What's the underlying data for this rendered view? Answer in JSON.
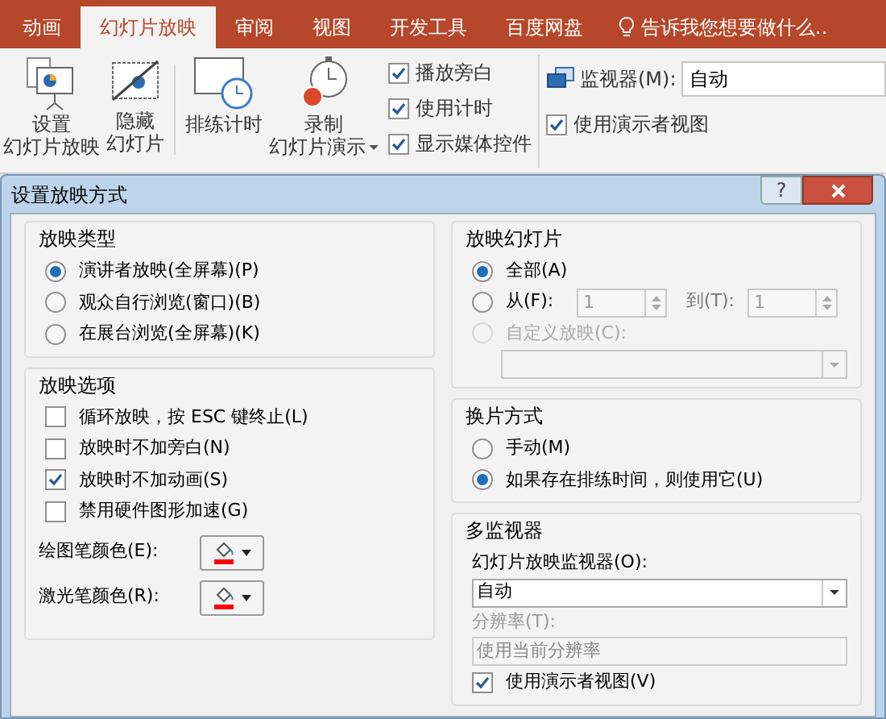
{
  "ribbon": {
    "tabs": [
      {
        "label": "动画",
        "selected": false
      },
      {
        "label": "幻灯片放映",
        "selected": true
      },
      {
        "label": "审阅",
        "selected": false
      },
      {
        "label": "视图",
        "selected": false
      },
      {
        "label": "开发工具",
        "selected": false
      },
      {
        "label": "百度网盘",
        "selected": false
      }
    ],
    "tell_me": "告诉我您想要做什么..",
    "buttons": [
      {
        "kind": "setup",
        "lines": [
          "设置",
          "幻灯片放映"
        ]
      },
      {
        "kind": "hide",
        "lines": [
          "隐藏",
          "幻灯片"
        ]
      },
      {
        "kind": "rehearse",
        "lines": [
          "排练计时"
        ]
      },
      {
        "kind": "record",
        "lines": [
          "录制",
          "幻灯片演示"
        ]
      }
    ],
    "checkboxes": [
      {
        "label": "播放旁白",
        "checked": true
      },
      {
        "label": "使用计时",
        "checked": true
      },
      {
        "label": "显示媒体控件",
        "checked": true
      }
    ],
    "monitor": {
      "label": "监视器(M):",
      "value": "自动"
    },
    "presenter_view": {
      "label": "使用演示者视图",
      "checked": true
    }
  },
  "dialog": {
    "title": "设置放映方式",
    "help": "?",
    "show_type": {
      "title": "放映类型",
      "options": [
        {
          "label": "演讲者放映(全屏幕)(P)",
          "selected": true
        },
        {
          "label": "观众自行浏览(窗口)(B)",
          "selected": false
        },
        {
          "label": "在展台浏览(全屏幕)(K)",
          "selected": false
        }
      ]
    },
    "show_options": {
      "title": "放映选项",
      "checkboxes": [
        {
          "label": "循环放映，按 ESC 键终止(L)",
          "checked": false
        },
        {
          "label": "放映时不加旁白(N)",
          "checked": false
        },
        {
          "label": "放映时不加动画(S)",
          "checked": true
        },
        {
          "label": "禁用硬件图形加速(G)",
          "checked": false
        }
      ],
      "pens": [
        {
          "label": "绘图笔颜色(E):",
          "color": "#ff0000"
        },
        {
          "label": "激光笔颜色(R):",
          "color": "#ff0000"
        }
      ]
    },
    "show_slides": {
      "title": "放映幻灯片",
      "all": {
        "label": "全部(A)",
        "selected": true
      },
      "from": {
        "label": "从(F):",
        "selected": false,
        "value": "1",
        "to_label": "到(T):",
        "to_value": "1"
      },
      "custom": {
        "label": "自定义放映(C):",
        "selected": false,
        "disabled": true
      }
    },
    "advance": {
      "title": "换片方式",
      "options": [
        {
          "label": "手动(M)",
          "selected": false
        },
        {
          "label": "如果存在排练时间，则使用它(U)",
          "selected": true
        }
      ]
    },
    "multi_monitor": {
      "title": "多监视器",
      "monitor_label": "幻灯片放映监视器(O):",
      "monitor_value": "自动",
      "resolution_label": "分辨率(T):",
      "resolution_value": "使用当前分辨率",
      "resolution_disabled": true,
      "presenter_view": {
        "label": "使用演示者视图(V)",
        "checked": true
      }
    }
  }
}
